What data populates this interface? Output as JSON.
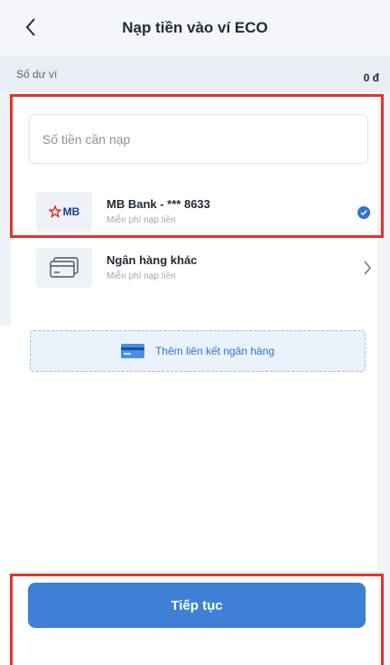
{
  "header": {
    "title": "Nạp tiền vào ví ECO"
  },
  "balance": {
    "label": "Số dư ví",
    "value": "0 đ"
  },
  "amount_input": {
    "placeholder": "Số tiền cần nạp",
    "value": ""
  },
  "banks": [
    {
      "logo_text": "MB",
      "name": "MB Bank - *** 8633",
      "subtitle": "Miễn phí nạp tiền",
      "selected": true
    },
    {
      "name": "Ngân hàng khác",
      "subtitle": "Miễn phí nạp tiền",
      "selected": false
    }
  ],
  "add_bank": {
    "label": "Thêm liên kết ngân hàng",
    "icon": "card-icon"
  },
  "footer": {
    "continue_label": "Tiếp tục"
  },
  "colors": {
    "accent": "#3f80d6",
    "highlight": "#e5322b",
    "mb_red": "#e2231a",
    "mb_blue": "#1e3a8a"
  }
}
